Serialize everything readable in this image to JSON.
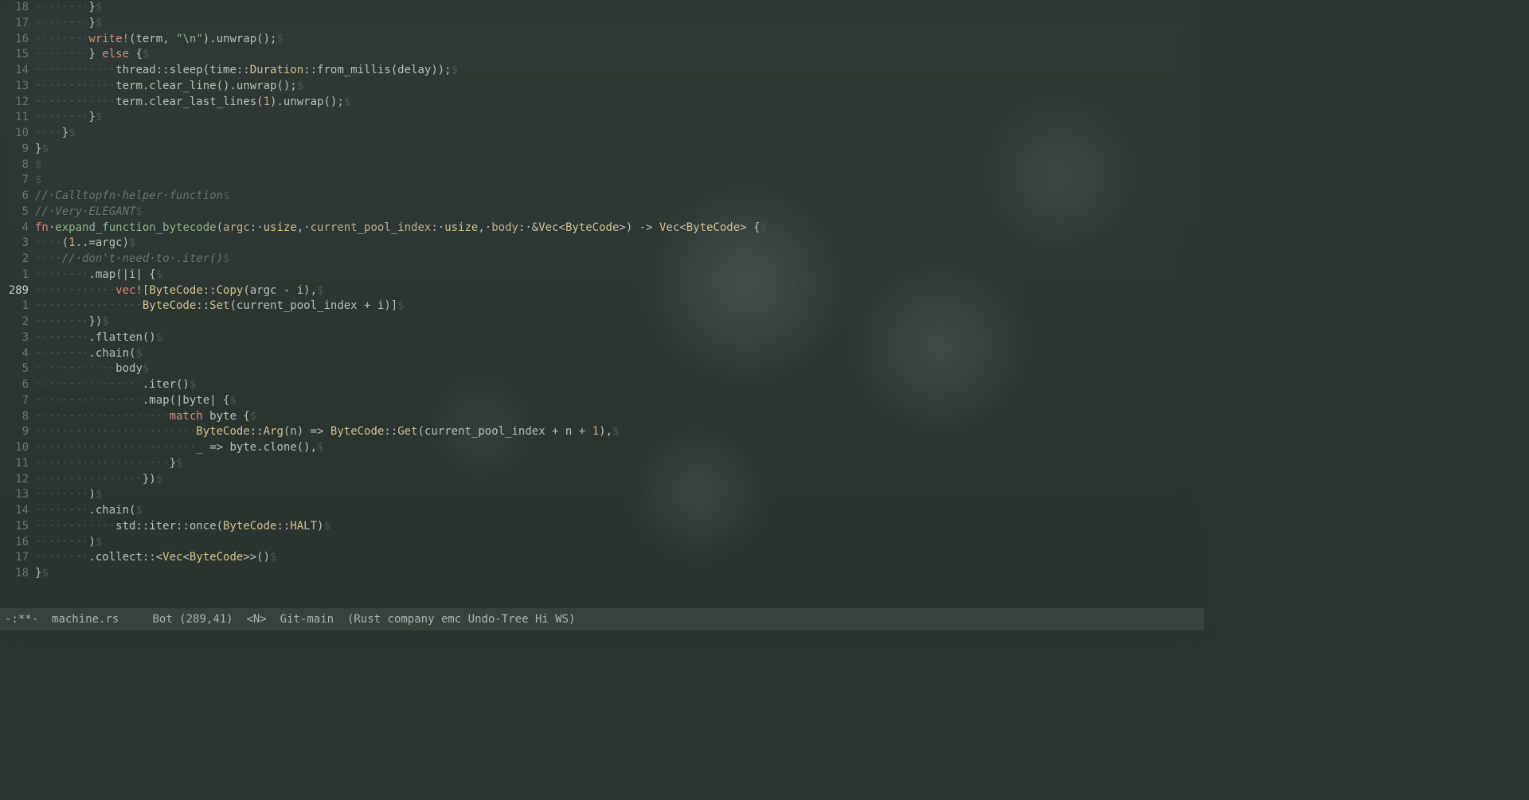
{
  "current_line_abs": 289,
  "lines": [
    {
      "rel": "18",
      "ws": "········",
      "t": [
        {
          "c": "op",
          "v": "}"
        }
      ]
    },
    {
      "rel": "17",
      "ws": "········",
      "t": [
        {
          "c": "op",
          "v": "}"
        }
      ]
    },
    {
      "rel": "16",
      "ws": "········",
      "t": [
        {
          "c": "macro",
          "v": "write!"
        },
        {
          "c": "op",
          "v": "(term, "
        },
        {
          "c": "str",
          "v": "\"\\n\""
        },
        {
          "c": "op",
          "v": ").unwrap();"
        }
      ]
    },
    {
      "rel": "15",
      "ws": "········",
      "t": [
        {
          "c": "op",
          "v": "} "
        },
        {
          "c": "kw",
          "v": "else"
        },
        {
          "c": "op",
          "v": " {"
        }
      ]
    },
    {
      "rel": "14",
      "ws": "············",
      "t": [
        {
          "c": "var",
          "v": "thread::sleep(time::"
        },
        {
          "c": "ty",
          "v": "Duration"
        },
        {
          "c": "var",
          "v": "::from_millis(delay));"
        }
      ]
    },
    {
      "rel": "13",
      "ws": "············",
      "t": [
        {
          "c": "var",
          "v": "term.clear_line().unwrap();"
        }
      ]
    },
    {
      "rel": "12",
      "ws": "············",
      "t": [
        {
          "c": "var",
          "v": "term.clear_last_lines("
        },
        {
          "c": "num",
          "v": "1"
        },
        {
          "c": "var",
          "v": ").unwrap();"
        }
      ]
    },
    {
      "rel": "11",
      "ws": "········",
      "t": [
        {
          "c": "op",
          "v": "}"
        }
      ]
    },
    {
      "rel": "10",
      "ws": "····",
      "t": [
        {
          "c": "op",
          "v": "}"
        }
      ]
    },
    {
      "rel": "9",
      "ws": "",
      "t": [
        {
          "c": "op",
          "v": "}"
        }
      ]
    },
    {
      "rel": "8",
      "ws": "",
      "t": []
    },
    {
      "rel": "7",
      "ws": "",
      "t": []
    },
    {
      "rel": "6",
      "ws": "",
      "t": [
        {
          "c": "comment",
          "v": "//·Calltopfn·helper·function"
        }
      ]
    },
    {
      "rel": "5",
      "ws": "",
      "t": [
        {
          "c": "comment",
          "v": "//·Very·ELEGANT"
        }
      ]
    },
    {
      "rel": "4",
      "ws": "",
      "t": [
        {
          "c": "kw",
          "v": "fn"
        },
        {
          "c": "var",
          "v": "·"
        },
        {
          "c": "fn",
          "v": "expand_function_bytecode"
        },
        {
          "c": "op",
          "v": "("
        },
        {
          "c": "param",
          "v": "argc"
        },
        {
          "c": "op",
          "v": ":·"
        },
        {
          "c": "ty",
          "v": "usize"
        },
        {
          "c": "op",
          "v": ",·"
        },
        {
          "c": "param",
          "v": "current_pool_index"
        },
        {
          "c": "op",
          "v": ":·"
        },
        {
          "c": "ty",
          "v": "usize"
        },
        {
          "c": "op",
          "v": ",·"
        },
        {
          "c": "param",
          "v": "body"
        },
        {
          "c": "op",
          "v": ":·&"
        },
        {
          "c": "ty",
          "v": "Vec"
        },
        {
          "c": "op",
          "v": "<"
        },
        {
          "c": "ty",
          "v": "ByteCode"
        },
        {
          "c": "op",
          "v": ">) -> "
        },
        {
          "c": "ty",
          "v": "Vec"
        },
        {
          "c": "op",
          "v": "<"
        },
        {
          "c": "ty",
          "v": "ByteCode"
        },
        {
          "c": "op",
          "v": "> {"
        }
      ]
    },
    {
      "rel": "3",
      "ws": "····",
      "t": [
        {
          "c": "op",
          "v": "("
        },
        {
          "c": "num",
          "v": "1"
        },
        {
          "c": "op",
          "v": "..=argc)"
        }
      ]
    },
    {
      "rel": "2",
      "ws": "····",
      "t": [
        {
          "c": "comment",
          "v": "//·don't·need·to·.iter()"
        }
      ]
    },
    {
      "rel": "1",
      "ws": "········",
      "t": [
        {
          "c": "var",
          "v": ".map(|i| {"
        }
      ]
    },
    {
      "rel": "289",
      "current": true,
      "ws": "············",
      "t": [
        {
          "c": "macro",
          "v": "vec!"
        },
        {
          "c": "op",
          "v": "["
        },
        {
          "c": "ty",
          "v": "ByteCode"
        },
        {
          "c": "op",
          "v": "::"
        },
        {
          "c": "ty",
          "v": "Copy"
        },
        {
          "c": "op",
          "v": "(argc - i),"
        }
      ]
    },
    {
      "rel": "1",
      "ws": "················",
      "t": [
        {
          "c": "ty",
          "v": "ByteCode"
        },
        {
          "c": "op",
          "v": "::"
        },
        {
          "c": "ty",
          "v": "Set"
        },
        {
          "c": "op",
          "v": "(current_pool_index + i)]"
        }
      ]
    },
    {
      "rel": "2",
      "ws": "········",
      "t": [
        {
          "c": "op",
          "v": "})"
        }
      ]
    },
    {
      "rel": "3",
      "ws": "········",
      "t": [
        {
          "c": "var",
          "v": ".flatten()"
        }
      ]
    },
    {
      "rel": "4",
      "ws": "········",
      "t": [
        {
          "c": "var",
          "v": ".chain("
        }
      ]
    },
    {
      "rel": "5",
      "ws": "············",
      "t": [
        {
          "c": "var",
          "v": "body"
        }
      ]
    },
    {
      "rel": "6",
      "ws": "················",
      "t": [
        {
          "c": "var",
          "v": ".iter()"
        }
      ]
    },
    {
      "rel": "7",
      "ws": "················",
      "t": [
        {
          "c": "var",
          "v": ".map(|byte| {"
        }
      ]
    },
    {
      "rel": "8",
      "ws": "····················",
      "t": [
        {
          "c": "kw",
          "v": "match"
        },
        {
          "c": "var",
          "v": " byte {"
        }
      ]
    },
    {
      "rel": "9",
      "ws": "························",
      "t": [
        {
          "c": "ty",
          "v": "ByteCode"
        },
        {
          "c": "op",
          "v": "::"
        },
        {
          "c": "ty",
          "v": "Arg"
        },
        {
          "c": "op",
          "v": "(n) => "
        },
        {
          "c": "ty",
          "v": "ByteCode"
        },
        {
          "c": "op",
          "v": "::"
        },
        {
          "c": "ty",
          "v": "Get"
        },
        {
          "c": "op",
          "v": "(current_pool_index + n + "
        },
        {
          "c": "num",
          "v": "1"
        },
        {
          "c": "op",
          "v": "),"
        }
      ]
    },
    {
      "rel": "10",
      "ws": "························",
      "t": [
        {
          "c": "kw",
          "v": "_"
        },
        {
          "c": "op",
          "v": " => byte.clone(),"
        }
      ]
    },
    {
      "rel": "11",
      "ws": "····················",
      "t": [
        {
          "c": "op",
          "v": "}"
        }
      ]
    },
    {
      "rel": "12",
      "ws": "················",
      "t": [
        {
          "c": "op",
          "v": "})"
        }
      ]
    },
    {
      "rel": "13",
      "ws": "········",
      "t": [
        {
          "c": "op",
          "v": ")"
        }
      ]
    },
    {
      "rel": "14",
      "ws": "········",
      "t": [
        {
          "c": "var",
          "v": ".chain("
        }
      ]
    },
    {
      "rel": "15",
      "ws": "············",
      "t": [
        {
          "c": "var",
          "v": "std::iter::once("
        },
        {
          "c": "ty",
          "v": "ByteCode"
        },
        {
          "c": "op",
          "v": "::"
        },
        {
          "c": "ty",
          "v": "HALT"
        },
        {
          "c": "op",
          "v": ")"
        }
      ]
    },
    {
      "rel": "16",
      "ws": "········",
      "t": [
        {
          "c": "op",
          "v": ")"
        }
      ]
    },
    {
      "rel": "17",
      "ws": "········",
      "t": [
        {
          "c": "var",
          "v": ".collect::<"
        },
        {
          "c": "ty",
          "v": "Vec"
        },
        {
          "c": "op",
          "v": "<"
        },
        {
          "c": "ty",
          "v": "ByteCode"
        },
        {
          "c": "op",
          "v": ">>()"
        }
      ]
    },
    {
      "rel": "18",
      "ws": "",
      "t": [
        {
          "c": "op",
          "v": "}"
        }
      ]
    }
  ],
  "modeline": {
    "modified": "-:**-",
    "buffer": "machine.rs",
    "position": "Bot (289,41)",
    "state": "<N>",
    "vcs": "Git-main",
    "modes": "(Rust company emc Undo-Tree Hi WS)"
  },
  "eol_char": "$"
}
